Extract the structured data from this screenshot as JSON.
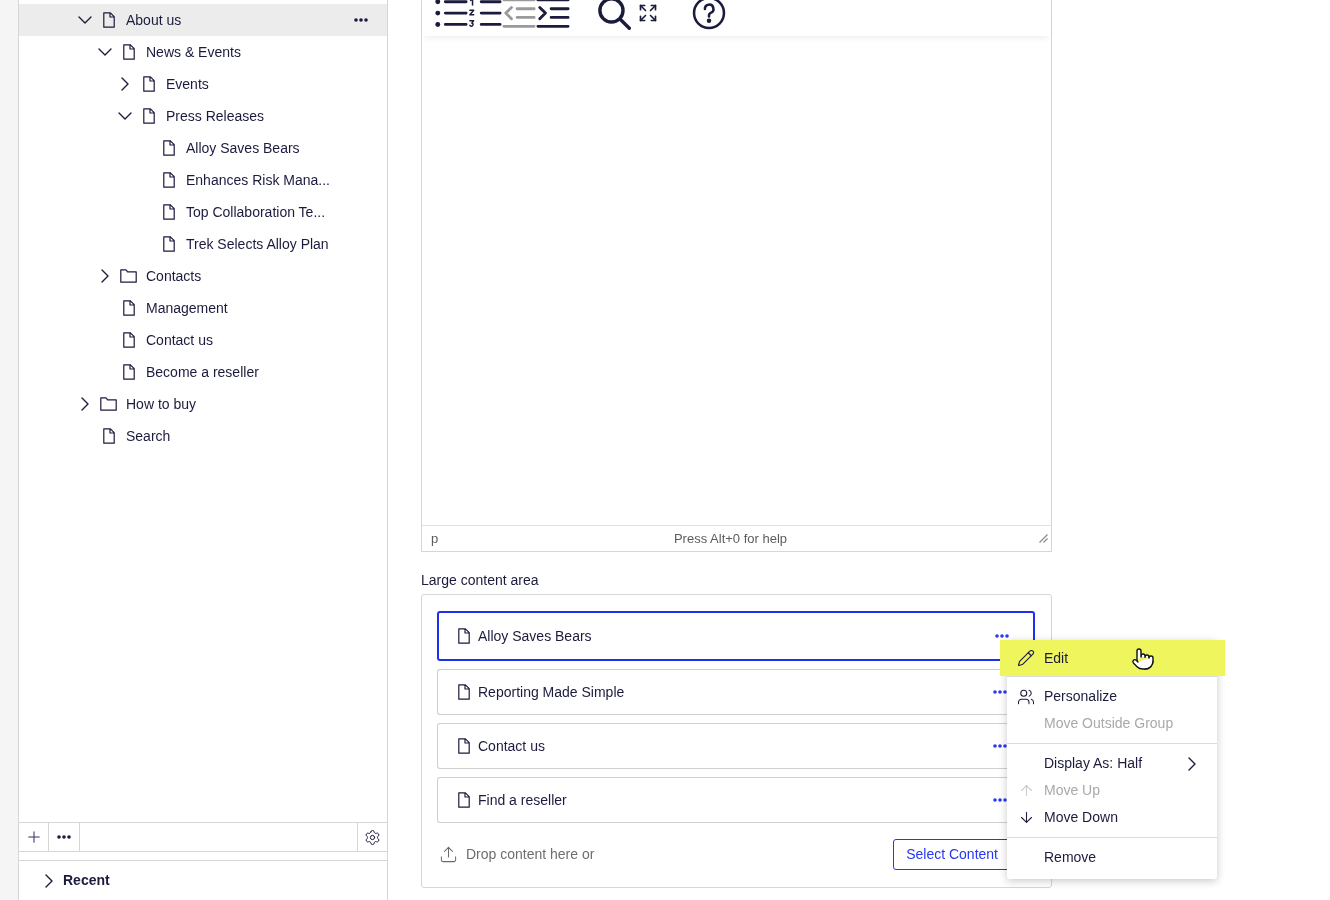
{
  "sidebar": {
    "tree": [
      {
        "label": "About us",
        "kind": "page",
        "expandable": true,
        "expanded": true,
        "selected": true,
        "children": [
          {
            "label": "News & Events",
            "kind": "page",
            "expandable": true,
            "expanded": true,
            "selected": false,
            "children": [
              {
                "label": "Events",
                "kind": "page",
                "expandable": true,
                "expanded": false,
                "selected": false
              },
              {
                "label": "Press Releases",
                "kind": "page",
                "expandable": true,
                "expanded": true,
                "selected": false,
                "children": [
                  {
                    "label": "Alloy Saves Bears",
                    "kind": "page",
                    "expandable": false,
                    "expanded": false,
                    "selected": false
                  },
                  {
                    "label": "Enhances Risk Mana...",
                    "kind": "page",
                    "expandable": false,
                    "expanded": false,
                    "selected": false
                  },
                  {
                    "label": "Top Collaboration Te...",
                    "kind": "page",
                    "expandable": false,
                    "expanded": false,
                    "selected": false
                  },
                  {
                    "label": "Trek Selects Alloy Plan",
                    "kind": "page",
                    "expandable": false,
                    "expanded": false,
                    "selected": false
                  }
                ]
              }
            ]
          },
          {
            "label": "Contacts",
            "kind": "folder",
            "expandable": true,
            "expanded": false,
            "selected": false
          },
          {
            "label": "Management",
            "kind": "page",
            "expandable": false,
            "expanded": false,
            "selected": false
          },
          {
            "label": "Contact us",
            "kind": "page",
            "expandable": false,
            "expanded": false,
            "selected": false
          },
          {
            "label": "Become a reseller",
            "kind": "page",
            "expandable": false,
            "expanded": false,
            "selected": false
          }
        ]
      },
      {
        "label": "How to buy",
        "kind": "folder",
        "expandable": true,
        "expanded": false,
        "selected": false
      },
      {
        "label": "Search",
        "kind": "page",
        "expandable": false,
        "expanded": false,
        "selected": false
      }
    ],
    "recent": {
      "label": "Recent",
      "expanded": false
    }
  },
  "editor": {
    "toolbar_groups": [
      [
        {
          "kind": "bullets",
          "disabled": false
        },
        {
          "kind": "numbers",
          "disabled": false
        },
        {
          "kind": "outdent",
          "disabled": true
        },
        {
          "kind": "indent",
          "disabled": false
        }
      ],
      [
        {
          "kind": "search",
          "disabled": false
        },
        {
          "kind": "fullscreen",
          "disabled": false
        }
      ],
      [
        {
          "kind": "help",
          "disabled": false
        }
      ]
    ],
    "element_path": "p",
    "help_text": "Press Alt+0 for help"
  },
  "content_area": {
    "label": "Large content area",
    "items": [
      {
        "label": "Alloy Saves Bears",
        "selected": true
      },
      {
        "label": "Reporting Made Simple",
        "selected": false
      },
      {
        "label": "Contact us",
        "selected": false
      },
      {
        "label": "Find a reseller",
        "selected": false
      }
    ],
    "drop_text": "Drop content here or",
    "select_button": "Select Content"
  },
  "context_menu": {
    "sections": [
      [
        {
          "label": "Edit",
          "kind": "edit",
          "highlighted": true,
          "disabled": false
        }
      ],
      [
        {
          "label": "Personalize",
          "kind": "personalize",
          "highlighted": false,
          "disabled": false
        },
        {
          "label": "Move Outside Group",
          "kind": "plain",
          "highlighted": false,
          "disabled": true
        }
      ],
      [
        {
          "label": "Display As: Half",
          "kind": "submenu",
          "highlighted": false,
          "disabled": false
        },
        {
          "label": "Move Up",
          "kind": "up",
          "highlighted": false,
          "disabled": true
        },
        {
          "label": "Move Down",
          "kind": "down",
          "highlighted": false,
          "disabled": false
        }
      ],
      [
        {
          "label": "Remove",
          "kind": "plain",
          "highlighted": false,
          "disabled": false
        }
      ]
    ]
  }
}
